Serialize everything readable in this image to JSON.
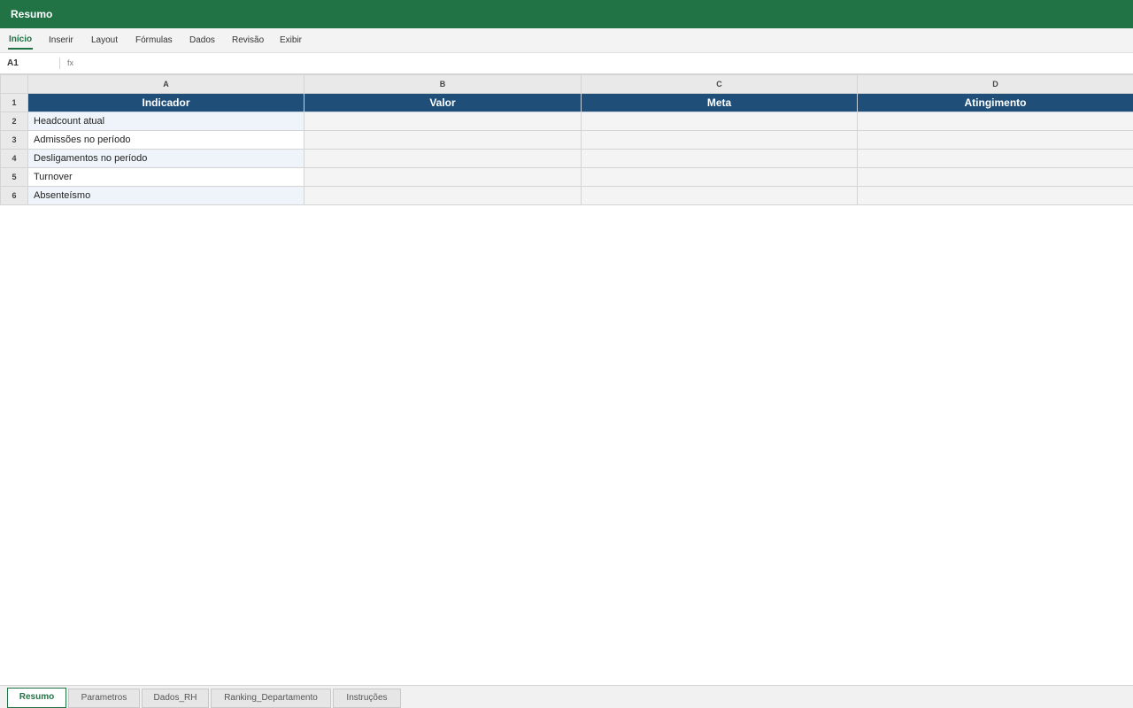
{
  "window": {
    "title": "Resumo"
  },
  "ribbon": {
    "tabs": [
      {
        "label": "Início",
        "active": true
      },
      {
        "label": "Inserir"
      },
      {
        "label": "Layout"
      },
      {
        "label": "Fórmulas"
      },
      {
        "label": "Dados"
      },
      {
        "label": "Revisão"
      },
      {
        "label": "Exibir"
      }
    ]
  },
  "formula_bar": {
    "name_box": "A1",
    "fx_label": "fx",
    "value": ""
  },
  "sheet": {
    "columns": [
      "A",
      "B",
      "C",
      "D"
    ],
    "rows": [
      "1",
      "2",
      "3",
      "4",
      "5",
      "6"
    ],
    "headers": [
      "Indicador",
      "Valor",
      "Meta",
      "Atingimento"
    ],
    "data": [
      [
        "Headcount atual",
        "",
        "",
        ""
      ],
      [
        "Admissões no período",
        "",
        "",
        ""
      ],
      [
        "Desligamentos no período",
        "",
        "",
        ""
      ],
      [
        "Turnover",
        "",
        "",
        ""
      ],
      [
        "Absenteísmo",
        "",
        "",
        ""
      ]
    ]
  },
  "sheet_tabs": [
    {
      "label": "Resumo",
      "active": true
    },
    {
      "label": "Parametros"
    },
    {
      "label": "Dados_RH"
    },
    {
      "label": "Ranking_Departamento"
    },
    {
      "label": "Instruções"
    }
  ],
  "colors": {
    "accent": "#217346",
    "header_fill": "#1f4e79",
    "band_fill": "#eff4fa"
  }
}
